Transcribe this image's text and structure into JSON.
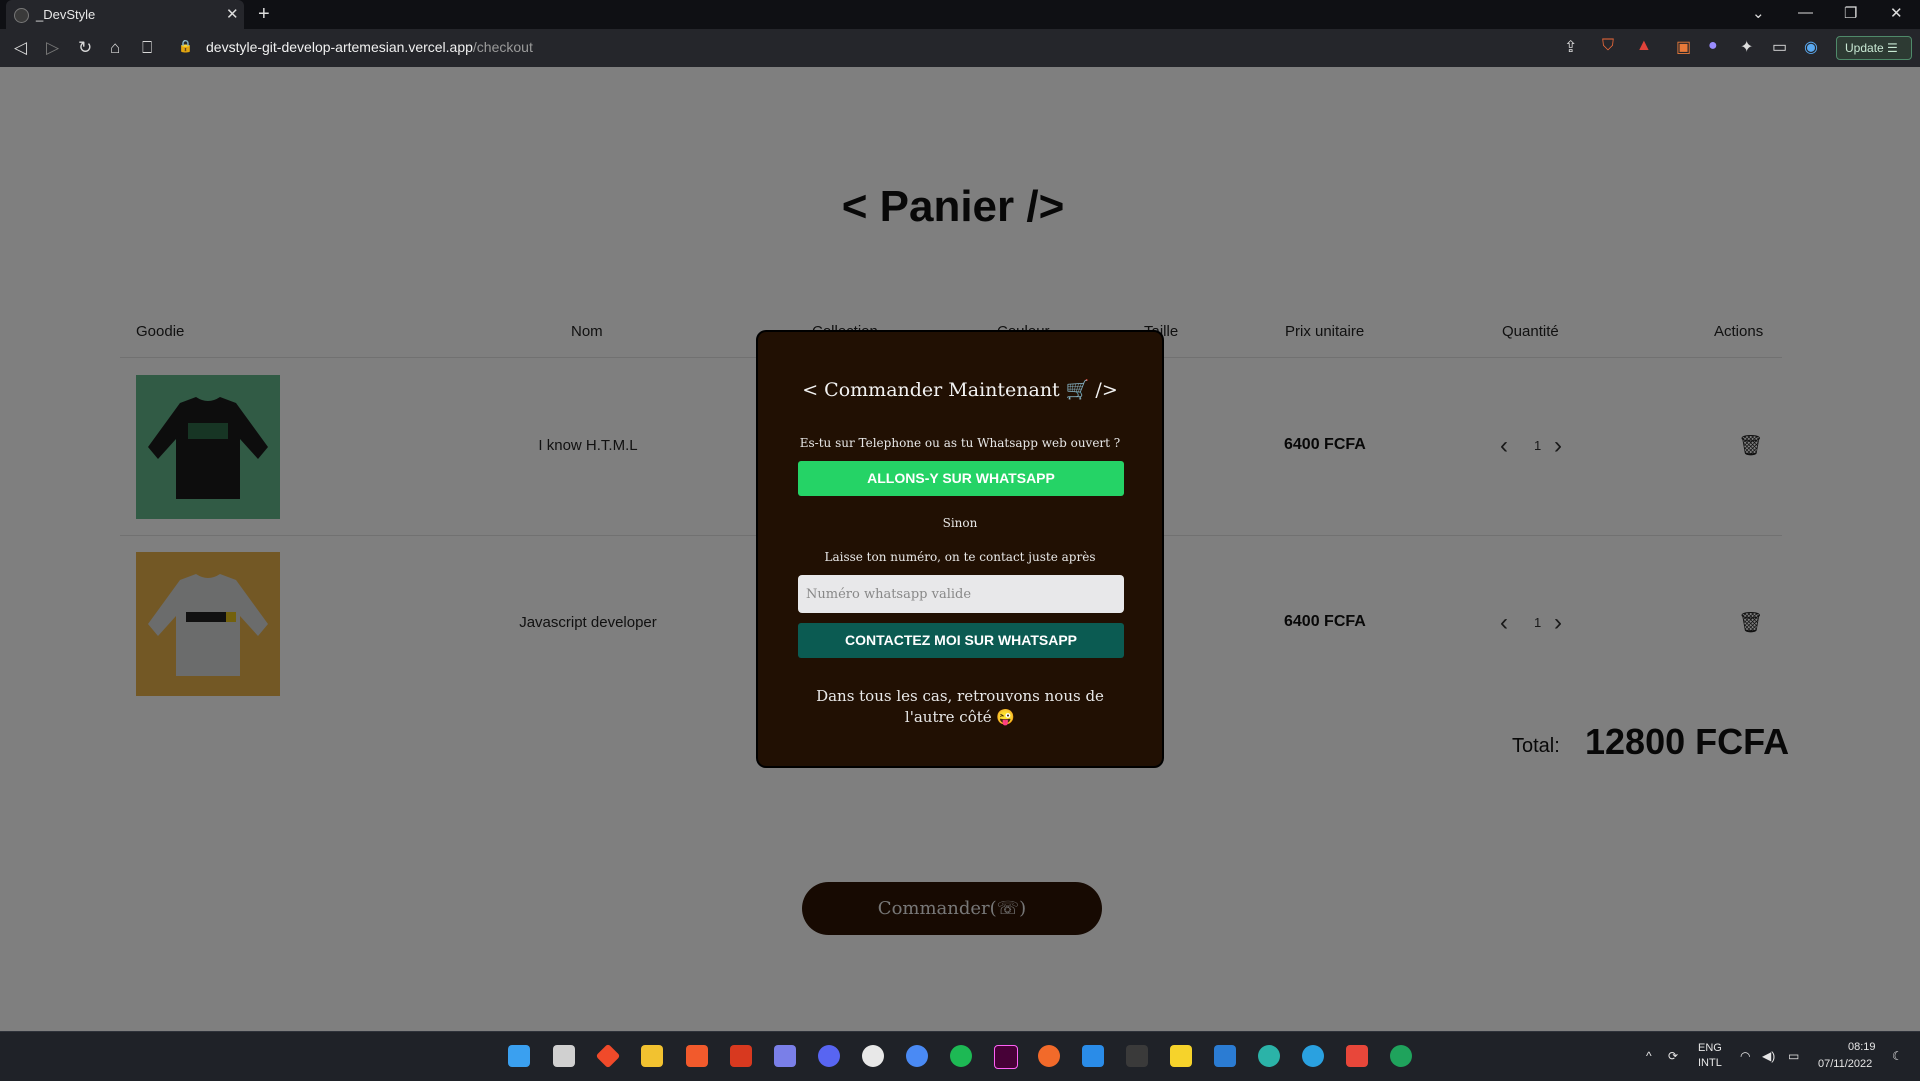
{
  "browser": {
    "tab_title": "_DevStyle",
    "tab_close": "✕",
    "new_tab": "+",
    "url_host": "devstyle-git-develop-artemesian.vercel.app",
    "url_path": "/checkout",
    "update_label": "Update ☰",
    "window_controls": {
      "dropdown": "⌄",
      "minimize": "—",
      "restore": "❐",
      "close": "✕"
    }
  },
  "page": {
    "title": "< Panier />",
    "table_headers": {
      "goodie": "Goodie",
      "nom": "Nom",
      "collection": "Collection",
      "couleur": "Couleur",
      "taille": "Taille",
      "prix": "Prix unitaire",
      "quantite": "Quantité",
      "actions": "Actions"
    },
    "items": [
      {
        "name": "I know H.T.M.L",
        "price": "6400 FCFA",
        "quantity": "1",
        "image_color": "#62b68b",
        "sweater_color": "#1a1a1a",
        "print_text": "I know H.T.M.L"
      },
      {
        "name": "Javascript developer",
        "price": "6400 FCFA",
        "quantity": "1",
        "image_color": "#e6b14a",
        "sweater_color": "#d7d8d9",
        "print_text": "JAVASCRIPT DEVELOPER JS"
      }
    ],
    "total_label": "Total:",
    "total_value": "12800 FCFA",
    "order_button": "Commander(☏)"
  },
  "modal": {
    "title": "< Commander Maintenant 🛒 />",
    "question": "Es-tu sur Telephone ou as tu Whatsapp web ouvert ?",
    "whatsapp_button": "ALLONS-Y SUR WHATSAPP",
    "sinon": "Sinon",
    "leave_number": "Laisse ton numéro, on te contact juste après",
    "phone_placeholder": "Numéro whatsapp valide",
    "contact_button": "CONTACTEZ MOI SUR WHATSAPP",
    "footer_line1": "Dans tous les cas, retrouvons nous de",
    "footer_line2": "l'autre côté 😜"
  },
  "taskbar": {
    "lang_line1": "ENG",
    "lang_line2": "INTL",
    "time": "08:19",
    "date": "07/11/2022"
  },
  "colors": {
    "modal_bg": "#211003",
    "whatsapp_green": "#25d366",
    "contact_teal": "#0b5b52",
    "order_button_bg": "#2e1505"
  }
}
